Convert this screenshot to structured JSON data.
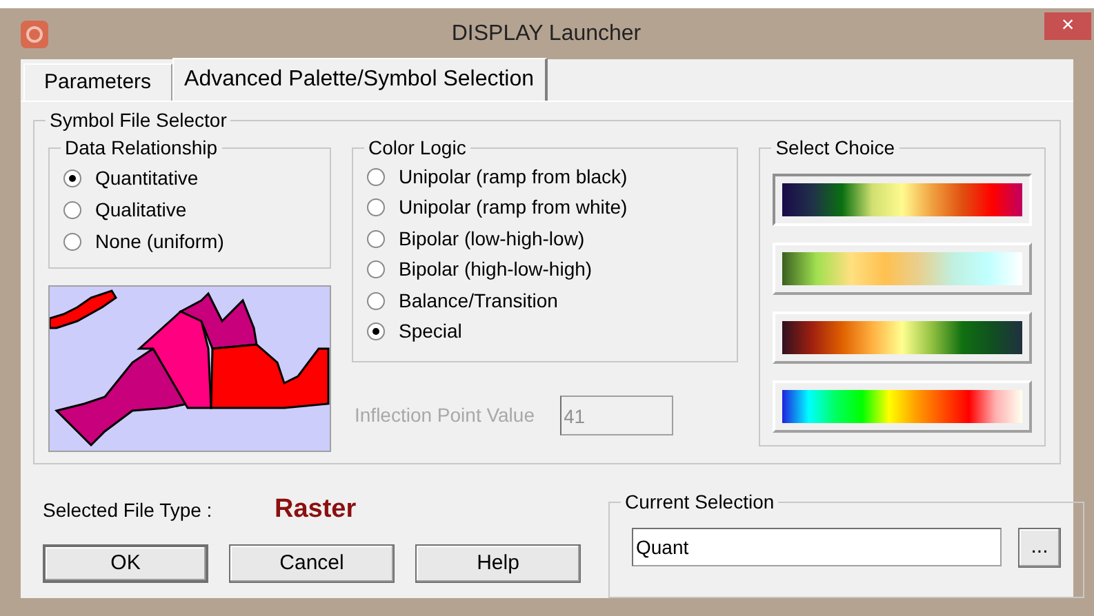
{
  "window": {
    "title": "DISPLAY Launcher",
    "close": "×"
  },
  "tabs": [
    {
      "label": "Parameters",
      "selected": false
    },
    {
      "label": "Advanced Palette/Symbol Selection",
      "selected": true
    }
  ],
  "symbol_file_selector": {
    "title": "Symbol File Selector",
    "data_relationship": {
      "title": "Data Relationship",
      "options": [
        {
          "label": "Quantitative",
          "selected": true
        },
        {
          "label": "Qualitative",
          "selected": false
        },
        {
          "label": "None (uniform)",
          "selected": false
        }
      ]
    },
    "color_logic": {
      "title": "Color Logic",
      "options": [
        {
          "label": "Unipolar (ramp from black)",
          "selected": false
        },
        {
          "label": "Unipolar (ramp from white)",
          "selected": false
        },
        {
          "label": "Bipolar (low-high-low)",
          "selected": false
        },
        {
          "label": "Bipolar (high-low-high)",
          "selected": false
        },
        {
          "label": "Balance/Transition",
          "selected": false
        },
        {
          "label": "Special",
          "selected": true
        }
      ]
    },
    "inflection": {
      "label": "Inflection Point Value",
      "value": "41",
      "disabled": true
    },
    "select_choice": {
      "title": "Select Choice",
      "choices": [
        {
          "selected": true
        },
        {
          "selected": false
        },
        {
          "selected": false
        },
        {
          "selected": false
        }
      ]
    }
  },
  "selected_file_type": {
    "label": "Selected File Type :",
    "value": "Raster"
  },
  "buttons": [
    "OK",
    "Cancel",
    "Help"
  ],
  "current_selection": {
    "title": "Current Selection",
    "value": "Quant",
    "browse": "..."
  }
}
